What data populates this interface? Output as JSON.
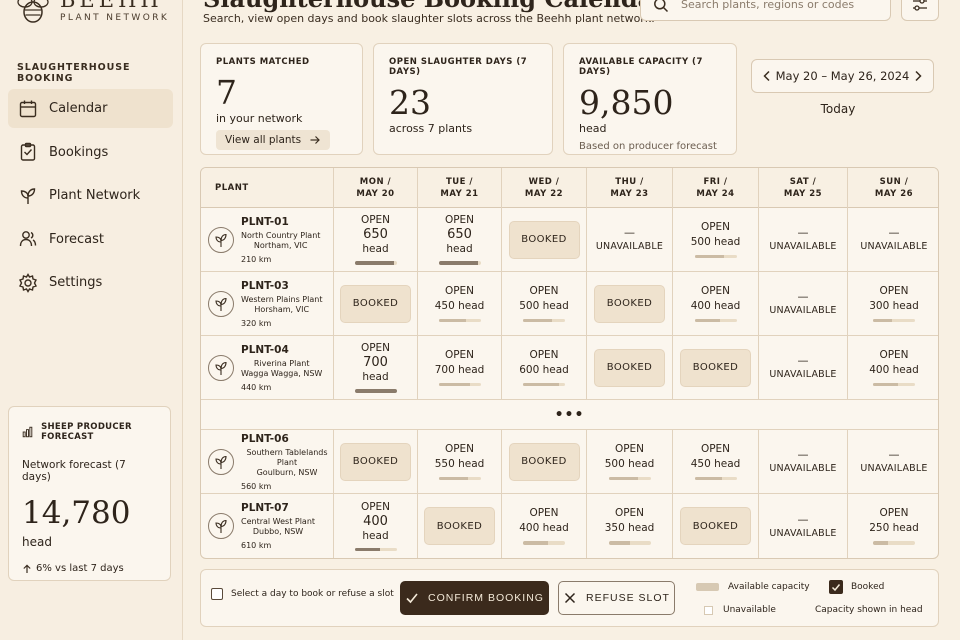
{
  "brand": {
    "name": "BEEHH",
    "subtitle": "PLANT NETWORK"
  },
  "sidebar": {
    "heading": "SLAUGHTERHOUSE BOOKING",
    "items": [
      {
        "label": "Calendar",
        "icon": "calendar-icon",
        "active": true
      },
      {
        "label": "Bookings",
        "icon": "bookings-icon"
      },
      {
        "label": "Plant Network",
        "icon": "plant-network-icon"
      },
      {
        "label": "Forecast",
        "icon": "forecast-icon"
      },
      {
        "label": "Settings",
        "icon": "settings-icon"
      }
    ],
    "forecast": {
      "heading": "SHEEP PRODUCER FORECAST",
      "label": "Network forecast (7 days)",
      "value": "14,780",
      "unit": "head",
      "change": "6% vs last 7 days"
    }
  },
  "header": {
    "title": "Slaughterhouse Booking Calendar",
    "subtitle": "Search, view open days and book slaughter slots across the Beehh plant network.",
    "search_placeholder": "Search plants, regions or codes"
  },
  "stats": {
    "plants": {
      "label": "PLANTS MATCHED",
      "value": "7",
      "sub": "in your network",
      "link": "View all plants"
    },
    "open_days": {
      "label": "OPEN SLAUGHTER DAYS (7 DAYS)",
      "value": "23",
      "sub": "across 7 plants"
    },
    "capacity": {
      "label": "AVAILABLE CAPACITY (7 DAYS)",
      "value": "9,850",
      "sub": "head",
      "note": "Based on producer forecast"
    }
  },
  "date_nav": {
    "range": "May 20 – May 26, 2024",
    "today": "Today"
  },
  "table": {
    "plant_header": "PLANT",
    "days": [
      {
        "day": "MON /",
        "date": "MAY 20"
      },
      {
        "day": "TUE /",
        "date": "MAY 21"
      },
      {
        "day": "WED /",
        "date": "MAY 22"
      },
      {
        "day": "THU /",
        "date": "MAY 23"
      },
      {
        "day": "FRI /",
        "date": "MAY 24"
      },
      {
        "day": "SAT /",
        "date": "MAY 25"
      },
      {
        "day": "SUN /",
        "date": "MAY 26"
      }
    ],
    "ellipsis": "•••",
    "rows": [
      {
        "code": "PLNT-01",
        "name": "North Country Plant",
        "location": "Northam, VIC",
        "distance": "210 km",
        "cells": [
          {
            "status": "open",
            "label": "OPEN",
            "num": "650",
            "unit": "head",
            "style": "stacked",
            "fill": 0.95
          },
          {
            "status": "open",
            "label": "OPEN",
            "num": "650",
            "unit": "head",
            "style": "stacked",
            "fill": 0.95
          },
          {
            "status": "booked",
            "label": "BOOKED"
          },
          {
            "status": "unavailable",
            "dash": "—",
            "label": "UNAVAILABLE"
          },
          {
            "status": "open",
            "label": "OPEN",
            "text": "500 head",
            "style": "inline",
            "fill": 0.7
          },
          {
            "status": "unavailable",
            "dash": "—",
            "label": "UNAVAILABLE"
          },
          {
            "status": "unavailable",
            "dash": "—",
            "label": "UNAVAILABLE"
          }
        ]
      },
      {
        "code": "PLNT-03",
        "name": "Western Plains Plant",
        "location": "Horsham, VIC",
        "distance": "320 km",
        "cells": [
          {
            "status": "booked",
            "label": "BOOKED"
          },
          {
            "status": "open",
            "label": "OPEN",
            "text": "450 head",
            "style": "inline",
            "fill": 0.65
          },
          {
            "status": "open",
            "label": "OPEN",
            "text": "500 head",
            "style": "inline",
            "fill": 0.7
          },
          {
            "status": "booked",
            "label": "BOOKED"
          },
          {
            "status": "open",
            "label": "OPEN",
            "text": "400 head",
            "style": "inline",
            "fill": 0.6
          },
          {
            "status": "unavailable",
            "dash": "—",
            "label": "UNAVAILABLE"
          },
          {
            "status": "open",
            "label": "OPEN",
            "text": "300 head",
            "style": "inline",
            "fill": 0.45
          }
        ]
      },
      {
        "code": "PLNT-04",
        "name": "Riverina Plant",
        "location": "Wagga Wagga, NSW",
        "distance": "440 km",
        "cells": [
          {
            "status": "open",
            "label": "OPEN",
            "num": "700",
            "unit": "head",
            "style": "stacked",
            "fill": 1.0
          },
          {
            "status": "open",
            "label": "OPEN",
            "text": "700 head",
            "style": "inline",
            "fill": 0.75
          },
          {
            "status": "open",
            "label": "OPEN",
            "text": "600 head",
            "style": "inline",
            "fill": 0.85
          },
          {
            "status": "booked",
            "label": "BOOKED"
          },
          {
            "status": "booked",
            "label": "BOOKED"
          },
          {
            "status": "unavailable",
            "dash": "—",
            "label": "UNAVAILABLE"
          },
          {
            "status": "open",
            "label": "OPEN",
            "text": "400 head",
            "style": "inline",
            "fill": 0.6
          }
        ]
      },
      {
        "code": "PLNT-06",
        "name": "Southern Tablelands Plant",
        "location": "Goulburn, NSW",
        "distance": "560 km",
        "cells": [
          {
            "status": "booked",
            "label": "BOOKED"
          },
          {
            "status": "open",
            "label": "OPEN",
            "text": "550 head",
            "style": "inline",
            "fill": 0.7
          },
          {
            "status": "booked",
            "label": "BOOKED"
          },
          {
            "status": "open",
            "label": "OPEN",
            "text": "500 head",
            "style": "inline",
            "fill": 0.7
          },
          {
            "status": "open",
            "label": "OPEN",
            "text": "450 head",
            "style": "inline",
            "fill": 0.65
          },
          {
            "status": "unavailable",
            "dash": "—",
            "label": "UNAVAILABLE"
          },
          {
            "status": "unavailable",
            "dash": "—",
            "label": "UNAVAILABLE"
          }
        ]
      },
      {
        "code": "PLNT-07",
        "name": "Central West Plant",
        "location": "Dubbo, NSW",
        "distance": "610 km",
        "cells": [
          {
            "status": "open",
            "label": "OPEN",
            "num": "400",
            "unit": "head",
            "style": "stacked",
            "fill": 0.6
          },
          {
            "status": "booked",
            "label": "BOOKED"
          },
          {
            "status": "open",
            "label": "OPEN",
            "text": "400 head",
            "style": "inline",
            "fill": 0.6
          },
          {
            "status": "open",
            "label": "OPEN",
            "text": "350 head",
            "style": "inline",
            "fill": 0.5
          },
          {
            "status": "booked",
            "label": "BOOKED"
          },
          {
            "status": "unavailable",
            "dash": "—",
            "label": "UNAVAILABLE"
          },
          {
            "status": "open",
            "label": "OPEN",
            "text": "250 head",
            "style": "inline",
            "fill": 0.35
          }
        ]
      }
    ]
  },
  "footer": {
    "hint": "Select a day to book or refuse a slot",
    "confirm": "CONFIRM BOOKING",
    "refuse": "REFUSE SLOT",
    "legend": {
      "capacity": "Available capacity",
      "unavailable": "Unavailable",
      "booked": "Booked",
      "note": "Capacity shown in head"
    }
  },
  "colors": {
    "background": "#f8f0e3",
    "accent": "#3b2a1c",
    "border": "#d9c9b3",
    "booked_fill": "#efe2ce"
  }
}
